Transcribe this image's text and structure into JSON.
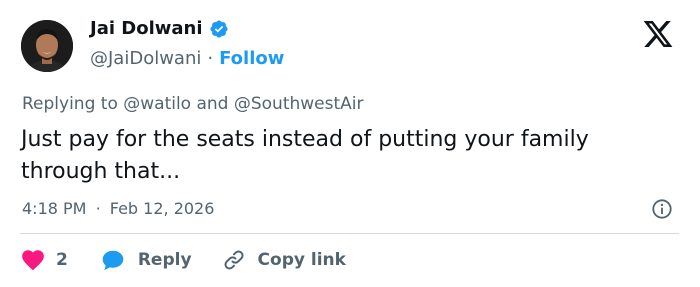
{
  "author": {
    "name": "Jai Dolwani",
    "handle": "@JaiDolwani",
    "separator": "·",
    "follow_label": "Follow"
  },
  "reply_context": "Replying to @watilo and @SouthwestAir",
  "tweet": {
    "text": "Just pay for the seats instead of putting your family through that..."
  },
  "timestamp": {
    "time": "4:18 PM",
    "separator": "·",
    "date": "Feb 12, 2026"
  },
  "actions": {
    "like_count": "2",
    "reply_label": "Reply",
    "copy_label": "Copy link"
  },
  "colors": {
    "accent": "#1d9bf0",
    "like": "#f91880",
    "muted_text": "#536471",
    "text": "#0f1419",
    "divider": "#cfd9de"
  },
  "icons": [
    "verified-badge-icon",
    "x-logo-icon",
    "info-icon",
    "heart-icon",
    "reply-bubble-icon",
    "link-icon"
  ]
}
